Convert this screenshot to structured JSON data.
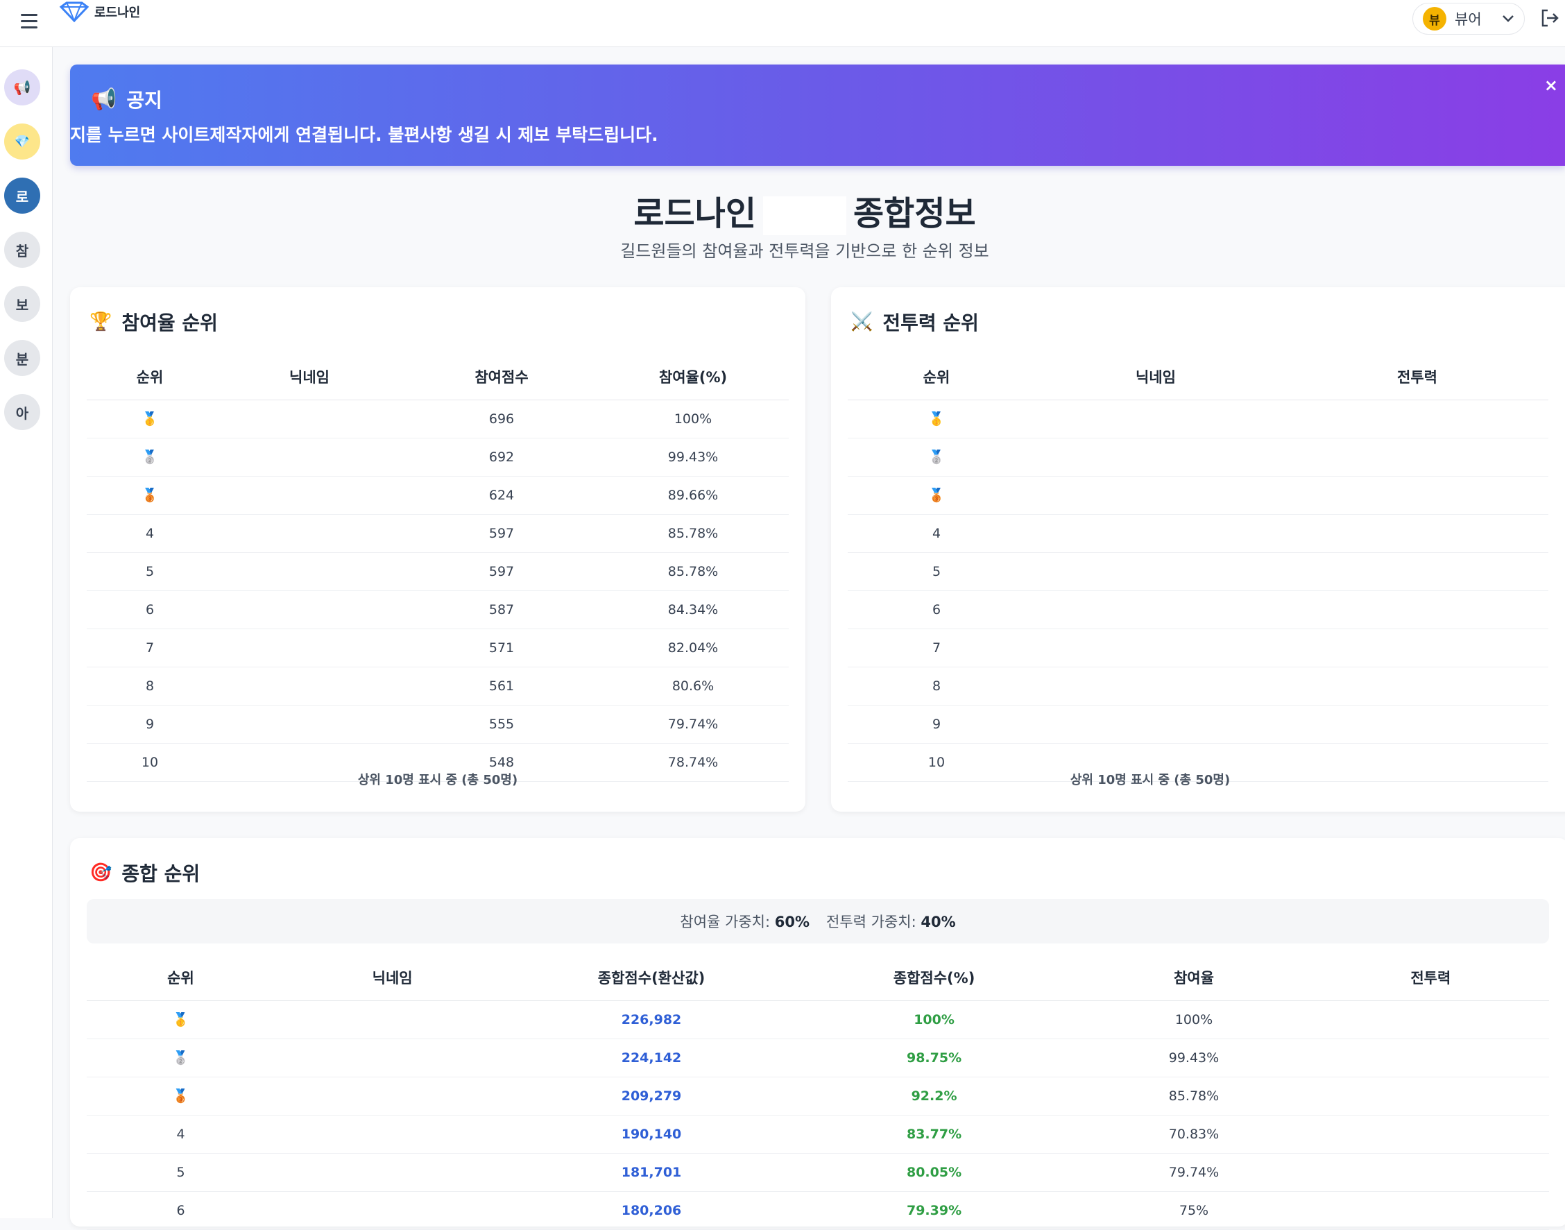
{
  "header": {
    "logo_text": "로드나인",
    "user": {
      "avatar_char": "뷰",
      "name": "뷰어"
    },
    "icons": {
      "menu": "hamburger-icon",
      "logout": "logout-icon",
      "dropdown": "chevron-down-icon"
    }
  },
  "sidebar": {
    "items": [
      {
        "label": "📢",
        "bg": "#e0dcf7"
      },
      {
        "label": "💎",
        "bg": "#fde68a"
      },
      {
        "label": "로",
        "bg": "#2f6fb3",
        "active": true
      },
      {
        "label": "참",
        "bg": "#e5e7eb"
      },
      {
        "label": "보",
        "bg": "#e5e7eb"
      },
      {
        "label": "분",
        "bg": "#e5e7eb"
      },
      {
        "label": "아",
        "bg": "#e5e7eb"
      }
    ]
  },
  "notice": {
    "title": "공지",
    "body": "지를 누르면 사이트제작자에게 연결됩니다. 불편사항 생길 시 제보 부탁드립니다.",
    "close": "×"
  },
  "page": {
    "title_left": "로드나인",
    "title_right": "종합정보",
    "subtitle": "길드원들의 참여율과 전투력을 기반으로 한 순위 정보"
  },
  "participation": {
    "title": "참여율 순위",
    "columns": [
      "순위",
      "닉네임",
      "참여점수",
      "참여율(%)"
    ],
    "rows": [
      {
        "rank": "🥇",
        "nick": "",
        "score": "696",
        "rate": "100%"
      },
      {
        "rank": "🥈",
        "nick": "",
        "score": "692",
        "rate": "99.43%"
      },
      {
        "rank": "🥉",
        "nick": "",
        "score": "624",
        "rate": "89.66%"
      },
      {
        "rank": "4",
        "nick": "",
        "score": "597",
        "rate": "85.78%"
      },
      {
        "rank": "5",
        "nick": "",
        "score": "597",
        "rate": "85.78%"
      },
      {
        "rank": "6",
        "nick": "",
        "score": "587",
        "rate": "84.34%"
      },
      {
        "rank": "7",
        "nick": "",
        "score": "571",
        "rate": "82.04%"
      },
      {
        "rank": "8",
        "nick": "",
        "score": "561",
        "rate": "80.6%"
      },
      {
        "rank": "9",
        "nick": "",
        "score": "555",
        "rate": "79.74%"
      },
      {
        "rank": "10",
        "nick": "",
        "score": "548",
        "rate": "78.74%"
      }
    ],
    "footer": "상위 10명 표시 중 (총 50명)"
  },
  "combat": {
    "title": "전투력 순위",
    "columns": [
      "순위",
      "닉네임",
      "전투력"
    ],
    "rows": [
      {
        "rank": "🥇",
        "nick": "",
        "power": ""
      },
      {
        "rank": "🥈",
        "nick": "",
        "power": ""
      },
      {
        "rank": "🥉",
        "nick": "",
        "power": ""
      },
      {
        "rank": "4",
        "nick": "",
        "power": ""
      },
      {
        "rank": "5",
        "nick": "",
        "power": ""
      },
      {
        "rank": "6",
        "nick": "",
        "power": ""
      },
      {
        "rank": "7",
        "nick": "",
        "power": ""
      },
      {
        "rank": "8",
        "nick": "",
        "power": ""
      },
      {
        "rank": "9",
        "nick": "",
        "power": ""
      },
      {
        "rank": "10",
        "nick": "",
        "power": ""
      }
    ],
    "footer": "상위 10명 표시 중 (총 50명)"
  },
  "overall": {
    "title": "종합 순위",
    "weight_participation_label": "참여율 가중치:",
    "weight_participation_value": "60%",
    "weight_combat_label": "전투력 가중치:",
    "weight_combat_value": "40%",
    "columns": [
      "순위",
      "닉네임",
      "종합점수(환산값)",
      "종합점수(%)",
      "참여율",
      "전투력"
    ],
    "rows": [
      {
        "rank": "🥇",
        "nick": "",
        "score": "226,982",
        "pct": "100%",
        "rate": "100%",
        "power": ""
      },
      {
        "rank": "🥈",
        "nick": "",
        "score": "224,142",
        "pct": "98.75%",
        "rate": "99.43%",
        "power": ""
      },
      {
        "rank": "🥉",
        "nick": "",
        "score": "209,279",
        "pct": "92.2%",
        "rate": "85.78%",
        "power": ""
      },
      {
        "rank": "4",
        "nick": "",
        "score": "190,140",
        "pct": "83.77%",
        "rate": "70.83%",
        "power": ""
      },
      {
        "rank": "5",
        "nick": "",
        "score": "181,701",
        "pct": "80.05%",
        "rate": "79.74%",
        "power": ""
      },
      {
        "rank": "6",
        "nick": "",
        "score": "180,206",
        "pct": "79.39%",
        "rate": "75%",
        "power": ""
      }
    ]
  },
  "colors": {
    "notice_gradient_start": "#4f7bef",
    "notice_gradient_end": "#8a3ee6",
    "score_blue": "#2f5fd6",
    "score_green": "#2f9e44"
  }
}
